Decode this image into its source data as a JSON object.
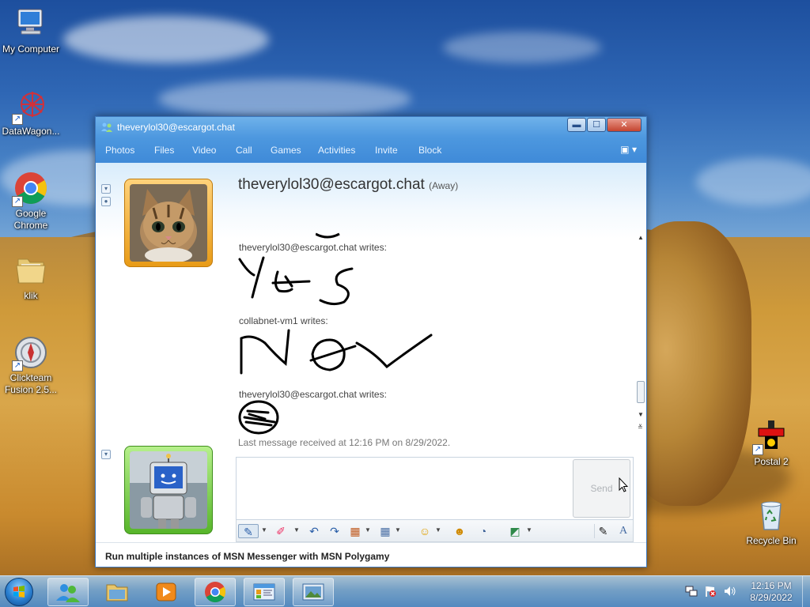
{
  "desktop": {
    "icons": [
      {
        "label": "My Computer"
      },
      {
        "label": "DataWagon..."
      },
      {
        "label": "Google Chrome"
      },
      {
        "label": "klik"
      },
      {
        "label": "Clickteam Fusion 2.5..."
      },
      {
        "label": "Postal 2"
      },
      {
        "label": "Recycle Bin"
      }
    ]
  },
  "window": {
    "title": "theverylol30@escargot.chat",
    "controls": {
      "minimize": "▬",
      "maximize": "☐",
      "close": "✕"
    },
    "menu": [
      "Photos",
      "Files",
      "Video",
      "Call",
      "Games",
      "Activities",
      "Invite",
      "Block"
    ],
    "contact": {
      "name": "theverylol30@escargot.chat",
      "status": "(Away)"
    },
    "messages": [
      {
        "writer": "theverylol30@escargot.chat writes:",
        "ink": "Yes"
      },
      {
        "writer": "collabnet-vm1 writes:",
        "ink": "Now"
      },
      {
        "writer": "theverylol30@escargot.chat writes:",
        "ink": "face"
      }
    ],
    "last_message": "Last message received at 12:16 PM on 8/29/2022.",
    "input_value": "",
    "send_label": "Send",
    "footer_text": "Run multiple instances of MSN Messenger with MSN Polygamy"
  },
  "taskbar": {
    "clock_time": "12:16 PM",
    "clock_date": "8/29/2022",
    "apps": [
      "msn-messenger",
      "windows-explorer",
      "media-player",
      "google-chrome",
      "messenger-window",
      "photo-viewer"
    ]
  },
  "colors": {
    "title_blue": "#4d98df",
    "accent_orange": "#e89b17",
    "accent_green": "#57b52a"
  }
}
